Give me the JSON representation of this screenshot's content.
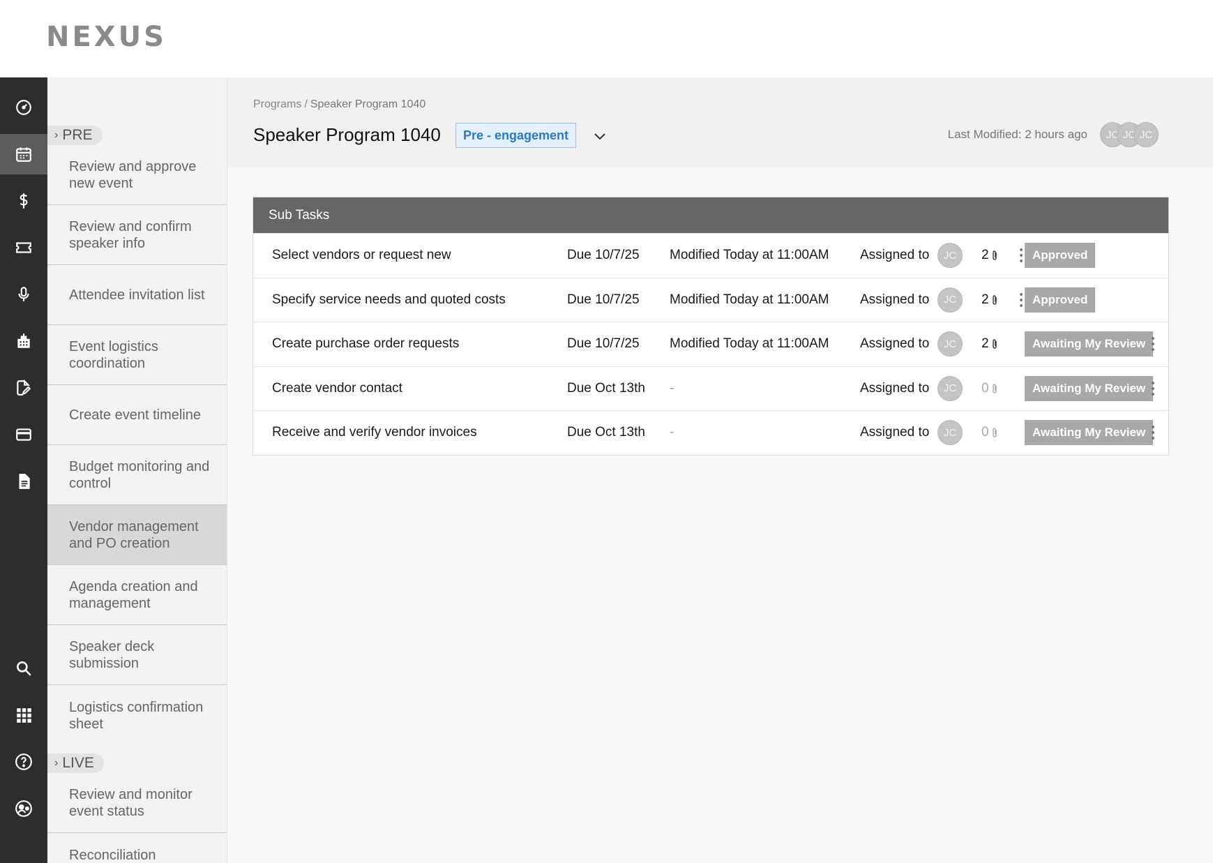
{
  "app": {
    "logo": "NEXUS"
  },
  "rail": {
    "items": [
      {
        "name": "dashboard",
        "icon": "gauge-icon",
        "active": false
      },
      {
        "name": "calendar",
        "icon": "calendar-icon",
        "active": true
      },
      {
        "name": "budget",
        "icon": "dollar-icon",
        "active": false
      },
      {
        "name": "tickets",
        "icon": "ticket-icon",
        "active": false
      },
      {
        "name": "speakers",
        "icon": "microphone-icon",
        "active": false
      },
      {
        "name": "venues",
        "icon": "building-icon",
        "active": false
      },
      {
        "name": "edit-docs",
        "icon": "document-edit-icon",
        "active": false
      },
      {
        "name": "payments",
        "icon": "credit-card-icon",
        "active": false
      },
      {
        "name": "files",
        "icon": "file-icon",
        "active": false
      },
      {
        "name": "search",
        "icon": "search-icon",
        "active": false
      },
      {
        "name": "apps",
        "icon": "grid-icon",
        "active": false
      },
      {
        "name": "help",
        "icon": "help-icon",
        "active": false
      },
      {
        "name": "profile",
        "icon": "user-circle-icon",
        "active": false
      }
    ]
  },
  "steps": {
    "pre_label": "PRE",
    "live_label": "LIVE",
    "pre_items": [
      "Review and approve new event",
      "Review and confirm speaker info",
      "Attendee invitation list",
      "Event logistics coordination",
      "Create event timeline",
      "Budget monitoring and control",
      "Vendor management and PO creation",
      "Agenda creation and management",
      "Speaker deck submission",
      "Logistics confirmation sheet"
    ],
    "active_item": "Vendor management and PO creation",
    "live_items": [
      "Review and monitor event status",
      "Reconciliation"
    ]
  },
  "header": {
    "breadcrumb_root": "Programs",
    "breadcrumb_sep": "/",
    "breadcrumb_current": "Speaker Program 1040",
    "title": "Speaker Program 1040",
    "stage": "Pre - engagement",
    "last_modified": "Last Modified: 2 hours ago",
    "collaborators": [
      "JC",
      "JC",
      "JC"
    ]
  },
  "subtasks": {
    "title": "Sub Tasks",
    "rows": [
      {
        "title": "Select vendors or request new",
        "due": "Due 10/7/25",
        "modified": "Modified Today at 11:00AM",
        "assigned_label": "Assigned to",
        "assignee": "JC",
        "attachments": "2",
        "status": "Approved"
      },
      {
        "title": "Specify service needs and quoted costs",
        "due": "Due 10/7/25",
        "modified": "Modified Today at 11:00AM",
        "assigned_label": "Assigned to",
        "assignee": "JC",
        "attachments": "2",
        "status": "Approved"
      },
      {
        "title": "Create purchase order requests",
        "due": "Due 10/7/25",
        "modified": "Modified Today at 11:00AM",
        "assigned_label": "Assigned to",
        "assignee": "JC",
        "attachments": "2",
        "status": "Awaiting My Review"
      },
      {
        "title": "Create vendor contact",
        "due": "Due Oct 13th",
        "modified": "-",
        "assigned_label": "Assigned to",
        "assignee": "JC",
        "attachments": "0",
        "status": "Awaiting My Review"
      },
      {
        "title": "Receive and verify vendor invoices",
        "due": "Due Oct 13th",
        "modified": "-",
        "assigned_label": "Assigned to",
        "assignee": "JC",
        "attachments": "0",
        "status": "Awaiting My Review"
      }
    ]
  },
  "colors": {
    "rail_bg": "#2d2d2d",
    "rail_active": "#5c5c5c",
    "badge_blue": "#2a79c9",
    "status_gray": "#a8a8a8",
    "card_header": "#666666"
  }
}
